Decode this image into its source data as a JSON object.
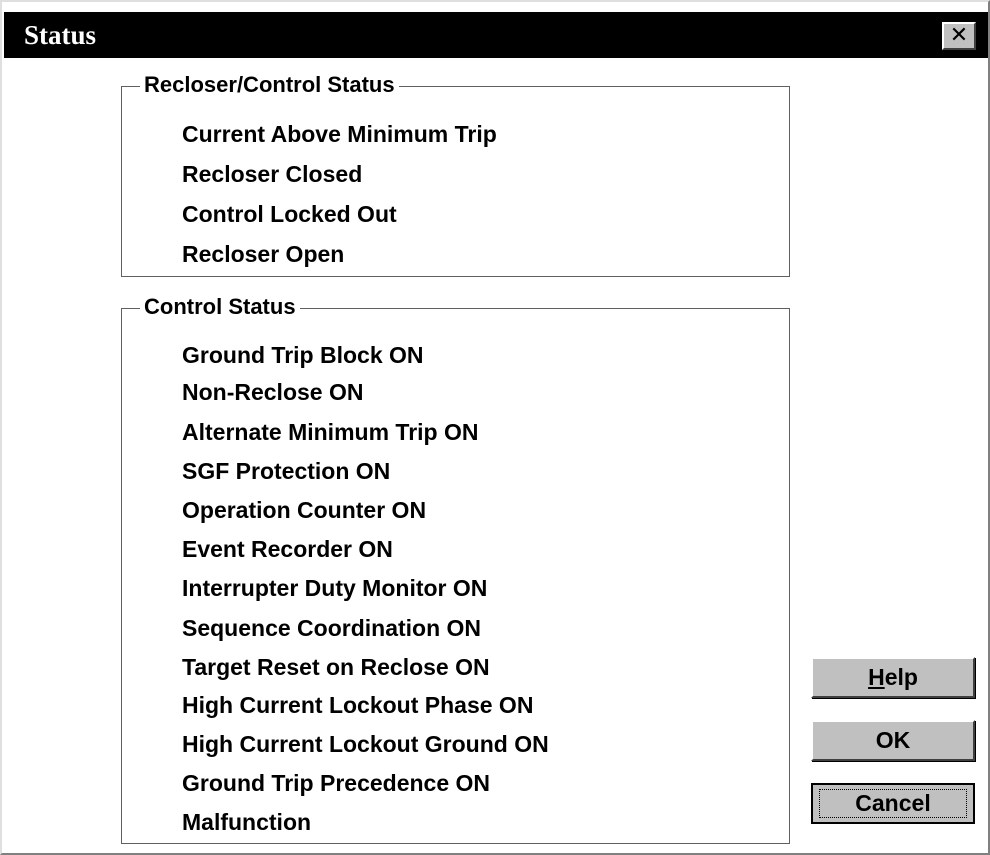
{
  "window": {
    "title": "Status",
    "close_glyph": "✕"
  },
  "recloser_control_status": {
    "legend": "Recloser/Control Status",
    "items": [
      "Current Above Minimum Trip",
      "Recloser Closed",
      "Control Locked Out",
      "Recloser Open"
    ]
  },
  "control_status": {
    "legend": "Control Status",
    "items": [
      "Ground Trip Block ON",
      "Non-Reclose ON",
      "Alternate Minimum Trip ON",
      "SGF Protection ON",
      "Operation Counter ON",
      "Event Recorder ON",
      "Interrupter Duty Monitor ON",
      "Sequence Coordination ON",
      "Target Reset on Reclose ON",
      "High Current Lockout Phase ON",
      "High Current Lockout Ground ON",
      "Ground Trip Precedence ON",
      "Malfunction"
    ]
  },
  "buttons": {
    "help_mnemonic": "H",
    "help_rest": "elp",
    "ok": "OK",
    "cancel": "Cancel"
  },
  "colors": {
    "titlebar": "#000000",
    "title_text": "#ffffff",
    "dialog_bg": "#ffffff",
    "button_face": "#c0c0c0"
  }
}
